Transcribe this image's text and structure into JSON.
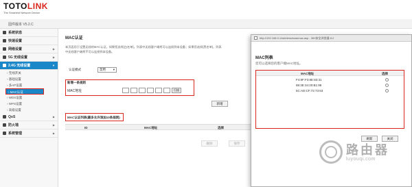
{
  "header": {
    "logo_toto": "TOTO",
    "logo_link": "LINK",
    "logo_sub": "The Smartest Network Device",
    "version": "固件版本 V5.2.C"
  },
  "sidebar": {
    "items": [
      {
        "label": "系统状态"
      },
      {
        "label": "快速设置"
      },
      {
        "label": "网络设置"
      },
      {
        "label": "5G 无线设置"
      },
      {
        "label": "2.4G 无线设置"
      }
    ],
    "subitems": [
      {
        "label": "无线开关"
      },
      {
        "label": "基础设置"
      },
      {
        "label": "多AP设置"
      },
      {
        "label": "MAC认证"
      },
      {
        "label": "WDS设置"
      },
      {
        "label": "WPS设置"
      },
      {
        "label": "高级设置"
      }
    ],
    "bottom_items": [
      {
        "label": "QoS"
      },
      {
        "label": "防火墙"
      },
      {
        "label": "系统管理"
      }
    ]
  },
  "main": {
    "title": "MAC认证",
    "desc1": "本页面用于设置无线的MAC认证，如果您选择[白名单]，列表中无线客户端将可以连接到本设备；如果您选择[黑名单]，列表",
    "desc2": "中无线客户端将不可以连接到本设备。",
    "mode_label": "认证模式",
    "mode_value": "禁用",
    "new_rule_title": "新增一条规则",
    "mac_label": "MAC地址",
    "scan_button": "扫描",
    "add_button": "新增",
    "list_title": "MAC认证列表(最多允许添加10条规则)",
    "table_headers": [
      "ID",
      "MAC地址",
      "选择"
    ],
    "delete_button": "删除",
    "save_button": "保存"
  },
  "popup": {
    "url": "http://192.168.0.1/wireless/scanmac.asp - 360安全浏览器 8.2",
    "title": "MAC列表",
    "desc": "您可以选择您的客户端MAC地址。",
    "headers": [
      "MAC地址",
      "选择"
    ],
    "rows": [
      {
        "mac": "F4:9F:F3:8E:83:31"
      },
      {
        "mac": "88:3E:34:20:B1:98"
      },
      {
        "mac": "5C:AD:CF:72:73:63"
      }
    ],
    "refresh_button": "刷新",
    "close_button": "关闭"
  },
  "watermark": {
    "text_cn": "路由器",
    "text_en": "luyouqi.com"
  },
  "colors": {
    "accent": "#1a87c9",
    "highlight": "#d9251c"
  }
}
